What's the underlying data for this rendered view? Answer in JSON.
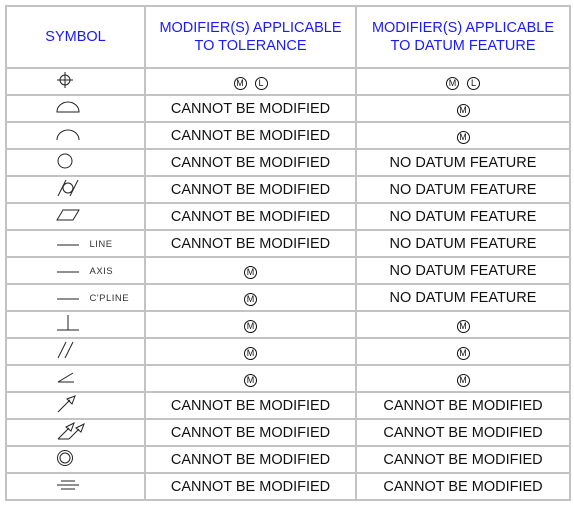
{
  "headers": {
    "symbol": "SYMBOL",
    "tolerance_line1": "MODIFIER(S) APPLICABLE",
    "tolerance_line2": "TO TOLERANCE",
    "datum_line1": "MODIFIER(S) APPLICABLE",
    "datum_line2": "TO DATUM FEATURE"
  },
  "colors": {
    "header_text": "#1a1aff",
    "grid": "#c3c3c3",
    "body_text": "#111111"
  },
  "rows": [
    {
      "symbol_icon": "position-icon",
      "suffix": "",
      "tolerance": {
        "mods": [
          "M",
          "L"
        ]
      },
      "datum": {
        "mods": [
          "M",
          "L"
        ]
      }
    },
    {
      "symbol_icon": "profile-of-surface-icon",
      "suffix": "",
      "tolerance": {
        "text": "CANNOT BE MODIFIED"
      },
      "datum": {
        "mods": [
          "M"
        ]
      }
    },
    {
      "symbol_icon": "profile-of-line-icon",
      "suffix": "",
      "tolerance": {
        "text": "CANNOT BE MODIFIED"
      },
      "datum": {
        "mods": [
          "M"
        ]
      }
    },
    {
      "symbol_icon": "circularity-icon",
      "suffix": "",
      "tolerance": {
        "text": "CANNOT BE MODIFIED"
      },
      "datum": {
        "text": "NO DATUM FEATURE"
      }
    },
    {
      "symbol_icon": "cylindricity-icon",
      "suffix": "",
      "tolerance": {
        "text": "CANNOT BE MODIFIED"
      },
      "datum": {
        "text": "NO DATUM FEATURE"
      }
    },
    {
      "symbol_icon": "flatness-icon",
      "suffix": "",
      "tolerance": {
        "text": "CANNOT BE MODIFIED"
      },
      "datum": {
        "text": "NO DATUM FEATURE"
      }
    },
    {
      "symbol_icon": "straightness-icon",
      "suffix": "LINE",
      "tolerance": {
        "text": "CANNOT BE MODIFIED"
      },
      "datum": {
        "text": "NO DATUM FEATURE"
      }
    },
    {
      "symbol_icon": "straightness-icon",
      "suffix": "AXIS",
      "tolerance": {
        "mods": [
          "M"
        ]
      },
      "datum": {
        "text": "NO DATUM FEATURE"
      }
    },
    {
      "symbol_icon": "straightness-icon",
      "suffix": "C'PLINE",
      "tolerance": {
        "mods": [
          "M"
        ]
      },
      "datum": {
        "text": "NO DATUM FEATURE"
      }
    },
    {
      "symbol_icon": "perpendicularity-icon",
      "suffix": "",
      "tolerance": {
        "mods": [
          "M"
        ]
      },
      "datum": {
        "mods": [
          "M"
        ]
      }
    },
    {
      "symbol_icon": "parallelism-icon",
      "suffix": "",
      "tolerance": {
        "mods": [
          "M"
        ]
      },
      "datum": {
        "mods": [
          "M"
        ]
      }
    },
    {
      "symbol_icon": "angularity-icon",
      "suffix": "",
      "tolerance": {
        "mods": [
          "M"
        ]
      },
      "datum": {
        "mods": [
          "M"
        ]
      }
    },
    {
      "symbol_icon": "circular-runout-icon",
      "suffix": "",
      "tolerance": {
        "text": "CANNOT BE MODIFIED"
      },
      "datum": {
        "text": "CANNOT BE MODIFIED"
      }
    },
    {
      "symbol_icon": "total-runout-icon",
      "suffix": "",
      "tolerance": {
        "text": "CANNOT BE MODIFIED"
      },
      "datum": {
        "text": "CANNOT BE MODIFIED"
      }
    },
    {
      "symbol_icon": "concentricity-icon",
      "suffix": "",
      "tolerance": {
        "text": "CANNOT BE MODIFIED"
      },
      "datum": {
        "text": "CANNOT BE MODIFIED"
      }
    },
    {
      "symbol_icon": "symmetry-icon",
      "suffix": "",
      "tolerance": {
        "text": "CANNOT BE MODIFIED"
      },
      "datum": {
        "text": "CANNOT BE MODIFIED"
      }
    }
  ]
}
